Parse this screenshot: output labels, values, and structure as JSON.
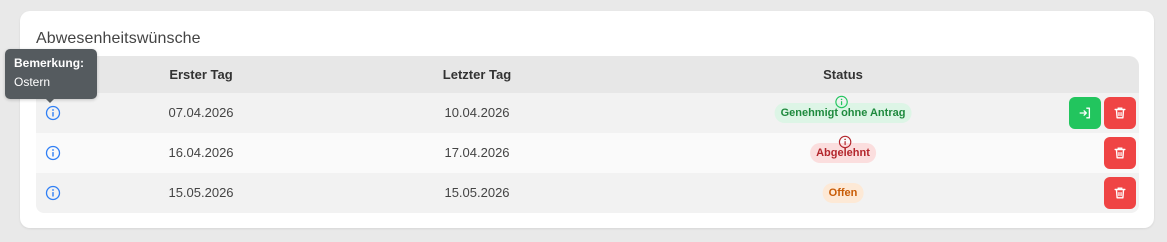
{
  "card": {
    "title": "Abwesenheitswünsche"
  },
  "table": {
    "columns": {
      "first_day": "Erster Tag",
      "last_day": "Letzter Tag",
      "status": "Status"
    },
    "rows": [
      {
        "first_day": "07.04.2026",
        "last_day": "10.04.2026",
        "status": "Genehmigt ohne Antrag",
        "status_variant": "green",
        "has_status_info": true,
        "has_submit_action": true
      },
      {
        "first_day": "16.04.2026",
        "last_day": "17.04.2026",
        "status": "Abgelehnt",
        "status_variant": "red",
        "has_status_info": true,
        "has_submit_action": false
      },
      {
        "first_day": "15.05.2026",
        "last_day": "15.05.2026",
        "status": "Offen",
        "status_variant": "orange",
        "has_status_info": false,
        "has_submit_action": false
      }
    ]
  },
  "tooltip": {
    "title": "Bemerkung:",
    "body": "Ostern"
  },
  "icons": {
    "row_info": "info-circle-icon",
    "status_info": "info-circle-icon",
    "submit": "sign-in-arrow-icon",
    "delete": "trash-icon"
  },
  "colors": {
    "accent_blue": "#2f7ff5",
    "success": "#22c55e",
    "danger": "#ef4444",
    "tooltip_bg": "#555b5f"
  }
}
